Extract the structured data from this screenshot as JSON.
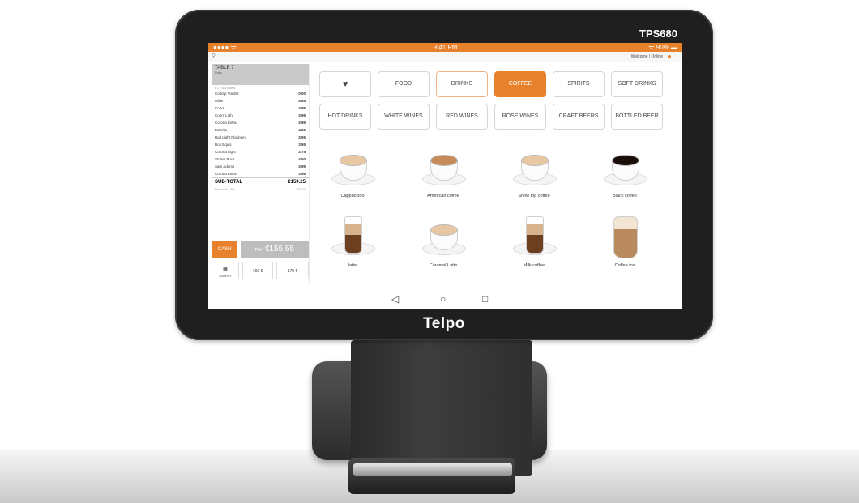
{
  "device": {
    "model": "TPS680",
    "brand": "Telpo"
  },
  "statusbar": {
    "signal": "●●●● ᯤ",
    "time": "9:41 PM",
    "battery": "ᯤ 90% ▬"
  },
  "topbar": {
    "welcome": "Welcome | Online"
  },
  "order": {
    "table": "TABLE 7",
    "table_sub": "Patio",
    "meta": "# 1-7 & 4 orders",
    "lines": [
      {
        "name": "Coltrap Voultot",
        "price": "0.00"
      },
      {
        "name": "Miller",
        "price": "4.85"
      },
      {
        "name": "Coors",
        "price": "4.85"
      },
      {
        "name": "Coors Light",
        "price": "3.95"
      },
      {
        "name": "Corona Extra",
        "price": "3.95"
      },
      {
        "name": "Estrella",
        "price": "4.25"
      },
      {
        "name": "Bud Light Platinum",
        "price": "3.95"
      },
      {
        "name": "Dos Equis",
        "price": "3.95"
      },
      {
        "name": "Corona Light",
        "price": "3.75"
      },
      {
        "name": "Stoner Buck",
        "price": "4.50"
      },
      {
        "name": "Sam Adams",
        "price": "3.95"
      },
      {
        "name": "Corona Extra",
        "price": "3.95"
      }
    ],
    "subtotal_label": "SUB-TOTAL",
    "subtotal_value": "€159.25",
    "discount_label": "Discount 10%",
    "discount_value": "€3.70",
    "cash_label": "CASH",
    "pay_label": "PAY",
    "pay_amount": "€155.55",
    "quantity_label": "QUANTITY",
    "quick_1": "160 €",
    "quick_2": "170 €"
  },
  "categories": [
    {
      "label": "♥",
      "state": "normal"
    },
    {
      "label": "FOOD",
      "state": "normal"
    },
    {
      "label": "DRINKS",
      "state": "outlined"
    },
    {
      "label": "COFFEE",
      "state": "active"
    },
    {
      "label": "SPIRITS",
      "state": "normal"
    },
    {
      "label": "SOFT DRINKS",
      "state": "normal"
    },
    {
      "label": "HOT DRINKS",
      "state": "normal"
    },
    {
      "label": "WHITE WINES",
      "state": "normal"
    },
    {
      "label": "RED WINES",
      "state": "normal"
    },
    {
      "label": "ROSE WINES",
      "state": "normal"
    },
    {
      "label": "CRAFT BEERS",
      "state": "normal"
    },
    {
      "label": "BOTTLED BEER",
      "state": "normal"
    }
  ],
  "products": [
    {
      "name": "Cappuccino",
      "image": "cappuccino-cup"
    },
    {
      "name": "American coffee",
      "image": "espresso-cup"
    },
    {
      "name": "Snow top coffee",
      "image": "foam-cup"
    },
    {
      "name": "Black coffee",
      "image": "black-coffee-cup"
    },
    {
      "name": "latte",
      "image": "latte-glass"
    },
    {
      "name": "Caramel Latte",
      "image": "caramel-latte-cup"
    },
    {
      "name": "Milk coffee",
      "image": "milk-coffee-glass"
    },
    {
      "name": "Coffee ice",
      "image": "iced-coffee-glass"
    }
  ],
  "navbar": {
    "back": "◁",
    "home": "○",
    "recents": "□"
  },
  "colors": {
    "accent": "#e8812c",
    "bezel": "#1f1f1f",
    "pay_button": "#bdbdbd"
  }
}
